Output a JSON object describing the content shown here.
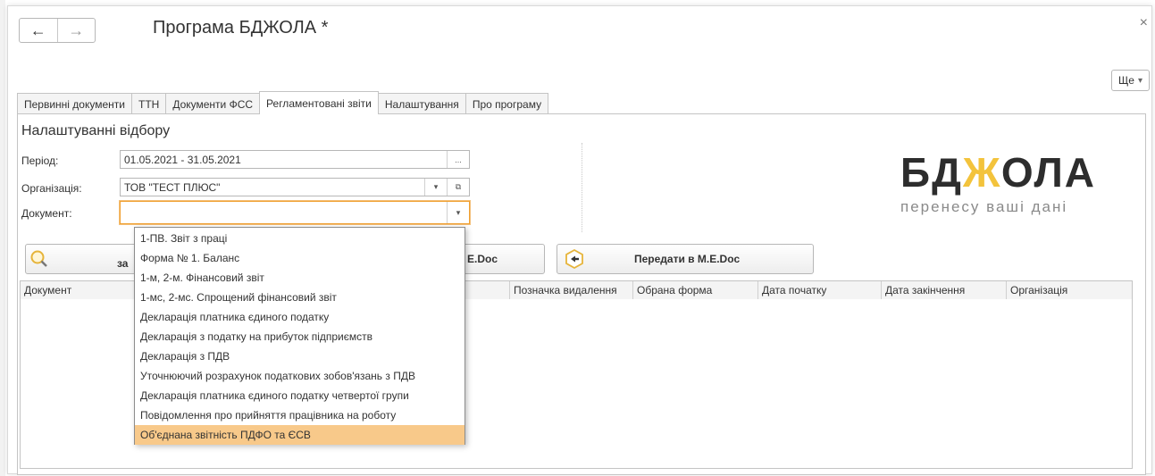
{
  "window": {
    "title": "Програма БДЖОЛА *",
    "close_glyph": "×"
  },
  "nav": {
    "back_glyph": "←",
    "forward_glyph": "→"
  },
  "more_button": {
    "label": "Ще",
    "arrow": "▾"
  },
  "tabs": [
    {
      "label": "Первинні документи",
      "active": false
    },
    {
      "label": "ТТН",
      "active": false
    },
    {
      "label": "Документи ФСС",
      "active": false
    },
    {
      "label": "Регламентовані звіти",
      "active": true
    },
    {
      "label": "Налаштування",
      "active": false
    },
    {
      "label": "Про програму",
      "active": false
    }
  ],
  "filter": {
    "title": "Налаштуванні відбору",
    "period": {
      "label": "Період:",
      "value": "01.05.2021 - 31.05.2021",
      "button": "..."
    },
    "organization": {
      "label": "Організація:",
      "value": "ТОВ \"ТЕСТ ПЛЮС\"",
      "arrow": "▾",
      "open_glyph": "⧉"
    },
    "document": {
      "label": "Документ:",
      "value": "",
      "arrow": "▾"
    }
  },
  "logo": {
    "part1": "БД",
    "part2": "Ж",
    "part3": "ОЛА",
    "subtitle": "перенесу ваші дані"
  },
  "buttons": {
    "search_partial": "за",
    "medoc_partial": "E.Doc",
    "transfer": "Передати в M.E.Doc"
  },
  "table": {
    "columns": [
      "Документ",
      "",
      "Позначка видалення",
      "Обрана форма",
      "Дата початку",
      "Дата закінчення",
      "Організація"
    ]
  },
  "dropdown": {
    "items": [
      "1-ПВ. Звіт з праці",
      "Форма № 1. Баланс",
      "1-м, 2-м. Фінансовий звіт",
      "1-мс, 2-мс. Спрощений фінансовий звіт",
      "Декларація платника єдиного податку",
      "Декларація з податку на прибуток підприємств",
      "Декларація з ПДВ",
      "Уточнюючий розрахунок податкових зобов'язань з ПДВ",
      "Декларація платника єдиного податку четвертої групи",
      "Повідомлення про прийняття працівника на роботу",
      "Об'єднана звітність ПДФО та ЄСВ"
    ],
    "selected_index": 10
  },
  "colors": {
    "accent": "#f3c33c",
    "selected": "#f8c98a",
    "focus": "#f0a030"
  }
}
